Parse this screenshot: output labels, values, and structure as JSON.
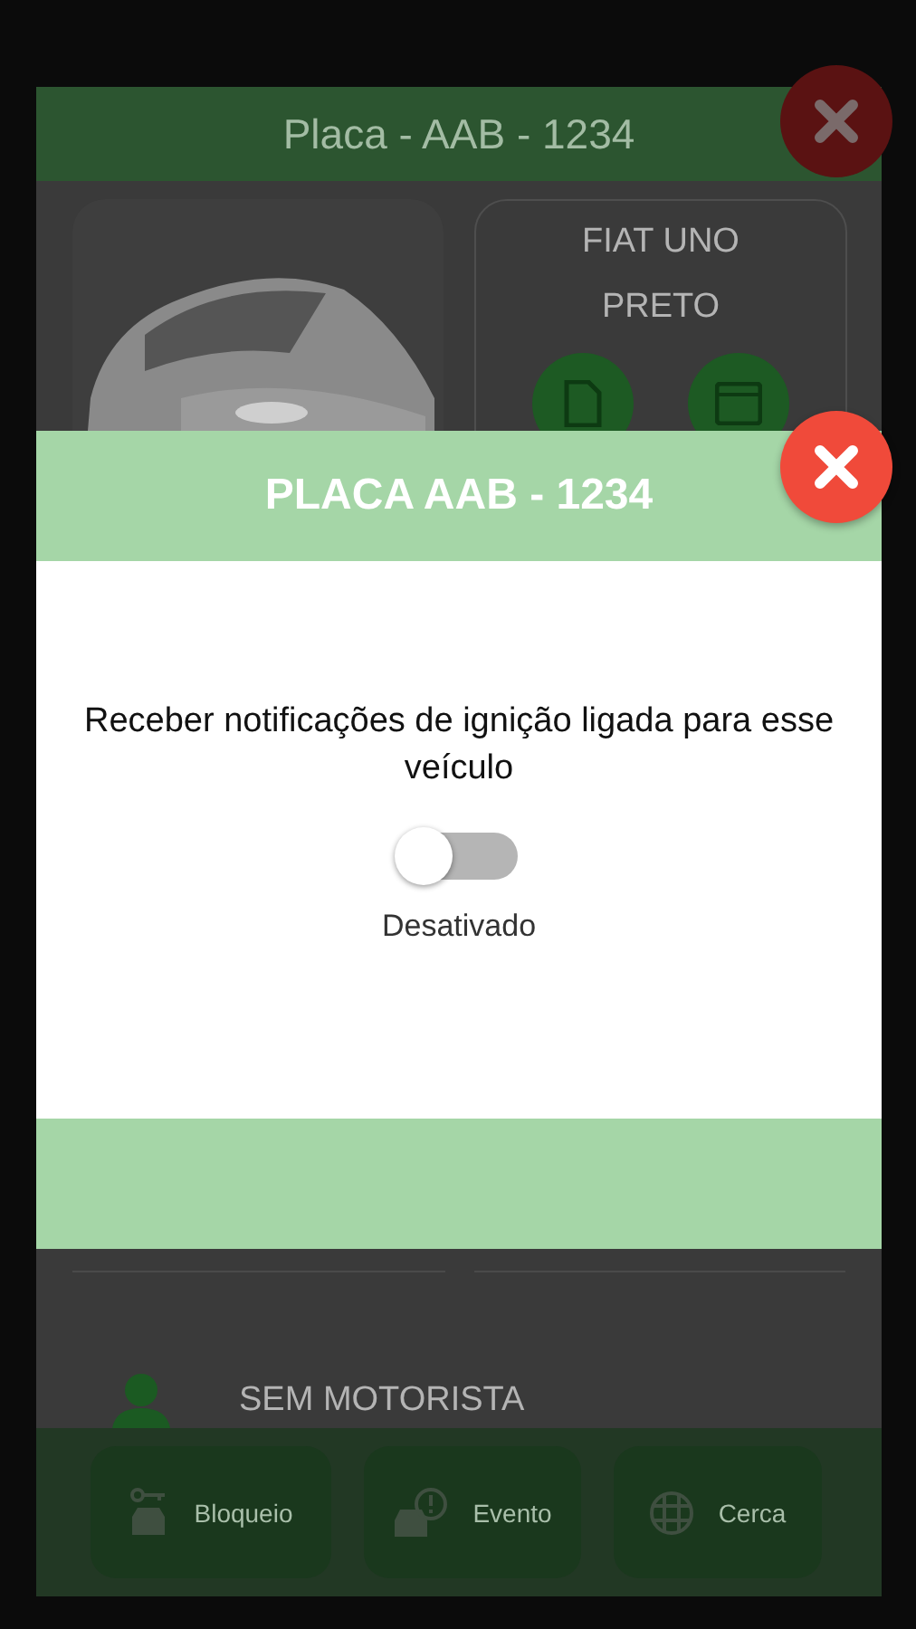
{
  "background_screen": {
    "title": "Placa - AAB - 1234",
    "model": "FIAT UNO",
    "color_name": "PRETO",
    "driver": "SEM MOTORISTA",
    "actions": [
      {
        "label": "Bloqueio",
        "kind": "lock"
      },
      {
        "label": "Evento",
        "kind": "event"
      },
      {
        "label": "Cerca",
        "kind": "fence"
      }
    ]
  },
  "dialog": {
    "title": "PLACA AAB - 1234",
    "message": "Receber notificações de ignição ligada para esse veículo",
    "toggle": {
      "on": false,
      "status": "Desativado"
    }
  }
}
